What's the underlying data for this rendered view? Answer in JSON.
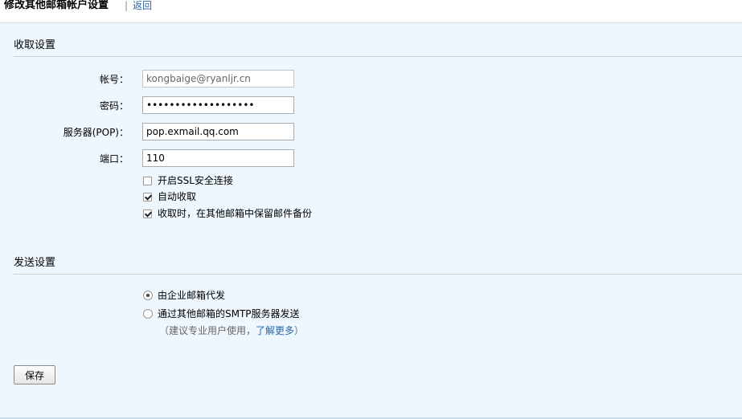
{
  "header": {
    "title": "修改其他邮箱帐户设置",
    "separator": "|",
    "back_link": "返回"
  },
  "receive": {
    "section_title": "收取设置",
    "account_label": "帐号：",
    "account_value": "kongbaige@ryanljr.cn",
    "password_label": "密码：",
    "password_mask": "•••••••••••••••••••",
    "server_label": "服务器(POP)：",
    "server_value": "pop.exmail.qq.com",
    "port_label": "端口：",
    "port_value": "110",
    "options": [
      {
        "label": "开启SSL安全连接",
        "checked": false
      },
      {
        "label": "自动收取",
        "checked": true
      },
      {
        "label": "收取时，在其他邮箱中保留邮件备份",
        "checked": true
      }
    ]
  },
  "send": {
    "section_title": "发送设置",
    "options": [
      {
        "label": "由企业邮箱代发",
        "selected": true
      },
      {
        "label": "通过其他邮箱的SMTP服务器发送",
        "selected": false
      }
    ],
    "hint_prefix": "（建议专业用户使用，",
    "hint_link": "了解更多",
    "hint_suffix": "）"
  },
  "footer": {
    "save_label": "保存"
  }
}
